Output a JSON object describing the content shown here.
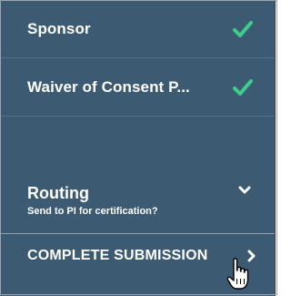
{
  "menu": {
    "items": [
      {
        "label": "Sponsor",
        "status_icon": "check-icon",
        "status_color": "#3ccf8e"
      },
      {
        "label": "Waiver of Consent P...",
        "status_icon": "check-icon",
        "status_color": "#3ccf8e"
      }
    ],
    "routing": {
      "title": "Routing",
      "subtitle": "Send to PI for certification?",
      "icon": "chevron-down-icon"
    },
    "complete": {
      "label": "COMPLETE SUBMISSION",
      "icon": "chevron-right-icon"
    }
  },
  "colors": {
    "panel_background": "#3d5a73",
    "text": "#ffffff",
    "check": "#3ccf8e"
  },
  "cursor": "hand-pointer-cursor"
}
